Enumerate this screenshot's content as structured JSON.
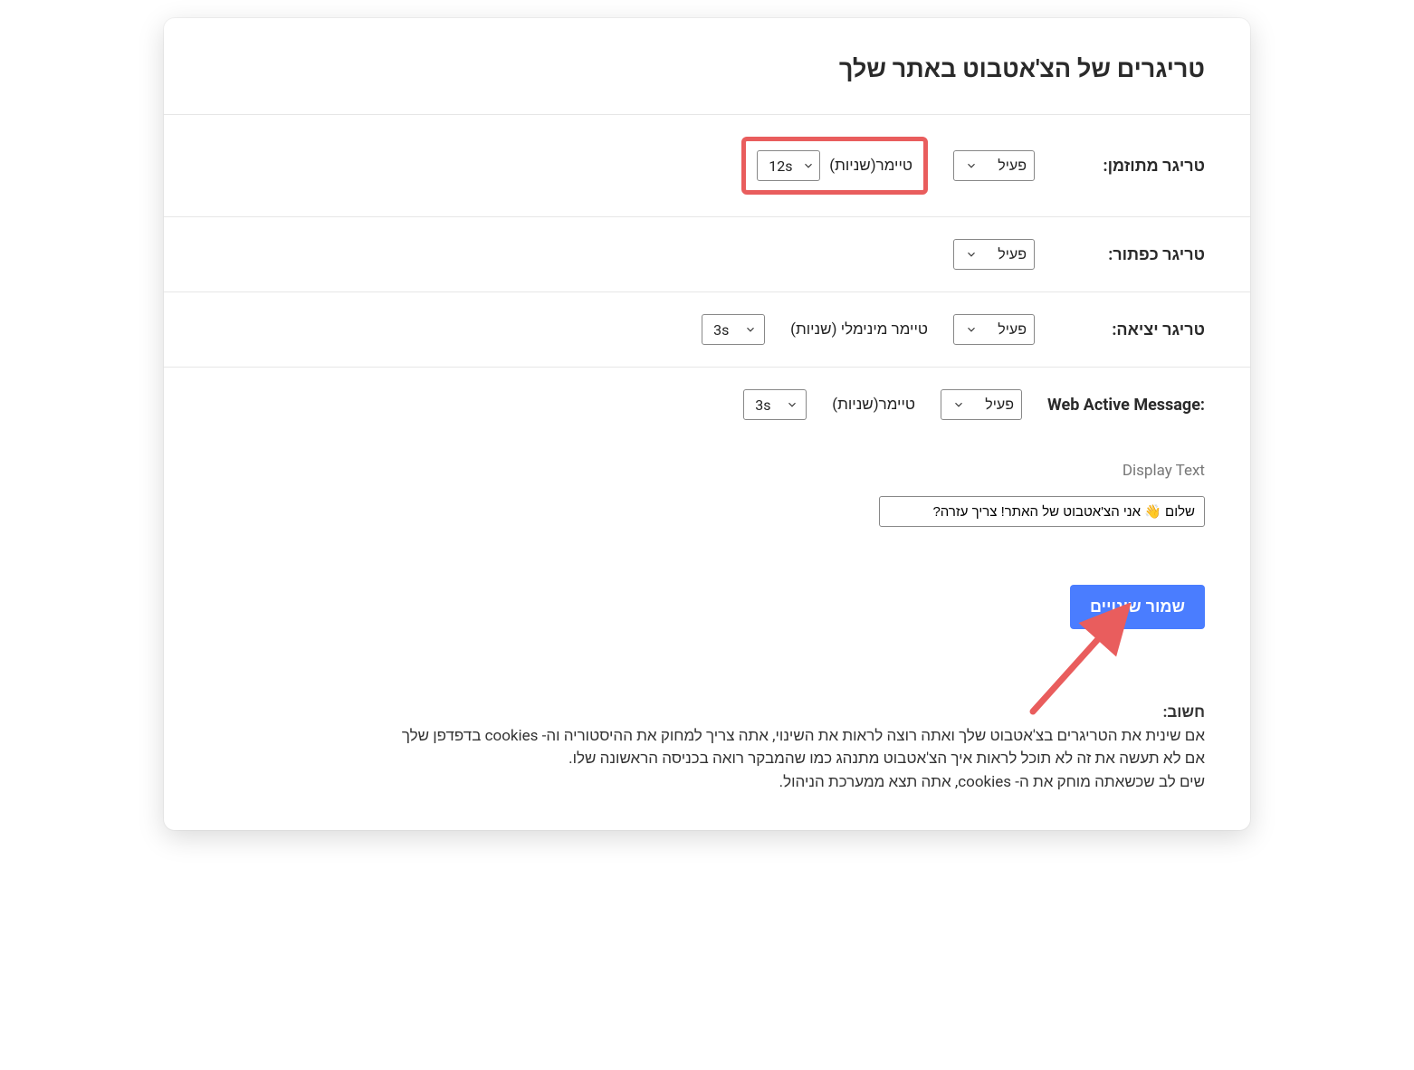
{
  "title": "טריגרים של הצ'אטבוט באתר שלך",
  "status_options_active": "פעיל",
  "rows": {
    "timed": {
      "label": "טריגר מתוזמן:",
      "status": "פעיל",
      "timer_label": "טיימר(שניות)",
      "timer_value": "12s"
    },
    "button": {
      "label": "טריגר כפתור:",
      "status": "פעיל"
    },
    "exit": {
      "label": "טריגר יציאה:",
      "status": "פעיל",
      "timer_label": "טיימר מינימלי (שניות)",
      "timer_value": "3s"
    },
    "wam": {
      "label": "Web Active Message:",
      "status": "פעיל",
      "timer_label": "טיימר(שניות)",
      "timer_value": "3s",
      "display_text_label": "Display Text",
      "display_text_value": "שלום 👋 אני הצ'אטבוט של האתר! צריך עזרה?"
    }
  },
  "save_button": "שמור שינויים",
  "important": {
    "head": "חשוב:",
    "line1": "אם שינית את הטריגרים בצ'אטבוט שלך ואתה רוצה לראות את השינוי, אתה צריך למחוק את ההיסטוריה וה- cookies בדפדפן שלך",
    "line2": "אם לא תעשה את זה לא תוכל לראות איך הצ'אטבוט מתנהג כמו שהמבקר רואה בכניסה הראשונה שלו.",
    "line3": "שים לב שכשאתה מוחק את ה- cookies, אתה תצא ממערכת הניהול."
  }
}
